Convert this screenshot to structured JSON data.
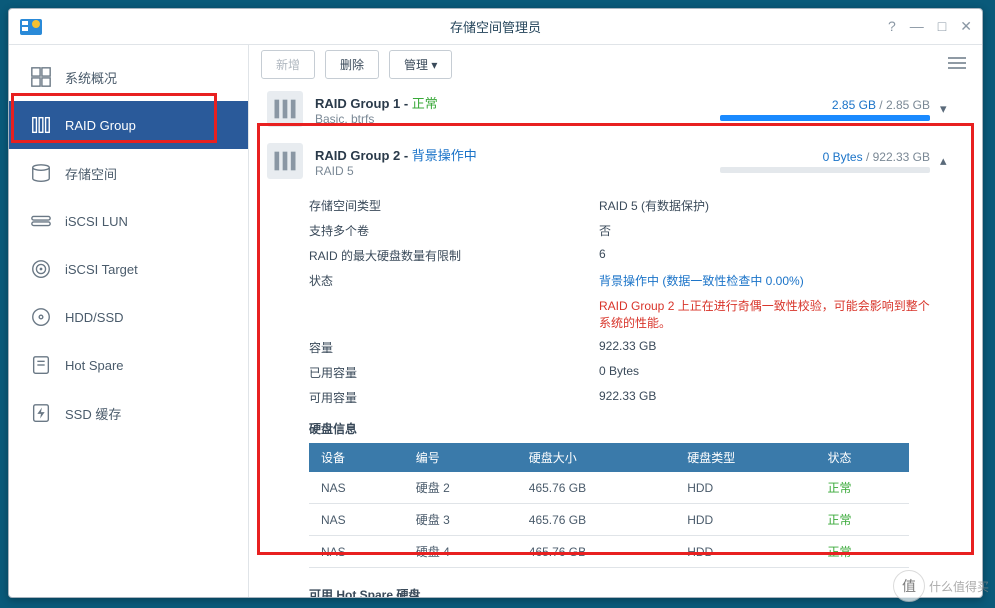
{
  "window": {
    "title": "存储空间管理员"
  },
  "sidebar": {
    "items": [
      {
        "label": "系统概况",
        "icon": "dashboard"
      },
      {
        "label": "RAID Group",
        "icon": "raid"
      },
      {
        "label": "存储空间",
        "icon": "volume"
      },
      {
        "label": "iSCSI LUN",
        "icon": "lun"
      },
      {
        "label": "iSCSI Target",
        "icon": "target"
      },
      {
        "label": "HDD/SSD",
        "icon": "hdd"
      },
      {
        "label": "Hot Spare",
        "icon": "spare"
      },
      {
        "label": "SSD 缓存",
        "icon": "cache"
      }
    ]
  },
  "toolbar": {
    "new": "新增",
    "delete": "删除",
    "manage": "管理 ▾"
  },
  "group1": {
    "name": "RAID Group 1",
    "status": "正常",
    "sub": "Basic, btrfs",
    "usage_used": "2.85 GB",
    "usage_total": "2.85 GB",
    "bar_pct": 100
  },
  "group2": {
    "name": "RAID Group 2",
    "status": "背景操作中",
    "sub": "RAID 5",
    "usage_used": "0 Bytes",
    "usage_total": "922.33 GB",
    "bar_pct": 0,
    "details": {
      "type_label": "存储空间类型",
      "type_value": "RAID 5 (有数据保护)",
      "multi_label": "支持多个卷",
      "multi_value": "否",
      "maxdisk_label": "RAID 的最大硬盘数量有限制",
      "maxdisk_value": "6",
      "state_label": "状态",
      "state_value": "背景操作中 (数据一致性检查中 0.00%)",
      "state_warning": "RAID Group 2 上正在进行奇偶一致性校验，可能会影响到整个系统的性能。",
      "cap_label": "容量",
      "cap_value": "922.33 GB",
      "used_label": "已用容量",
      "used_value": "0 Bytes",
      "avail_label": "可用容量",
      "avail_value": "922.33 GB",
      "diskinfo_label": "硬盘信息",
      "spare_label": "可用 Hot Spare 硬盘"
    },
    "disk_table": {
      "cols": {
        "device": "设备",
        "number": "编号",
        "size": "硬盘大小",
        "type": "硬盘类型",
        "state": "状态"
      },
      "rows": [
        {
          "device": "NAS",
          "number": "硬盘 2",
          "size": "465.76 GB",
          "type": "HDD",
          "state": "正常"
        },
        {
          "device": "NAS",
          "number": "硬盘 3",
          "size": "465.76 GB",
          "type": "HDD",
          "state": "正常"
        },
        {
          "device": "NAS",
          "number": "硬盘 4",
          "size": "465.76 GB",
          "type": "HDD",
          "state": "正常"
        }
      ]
    }
  },
  "watermark": "什么值得买"
}
